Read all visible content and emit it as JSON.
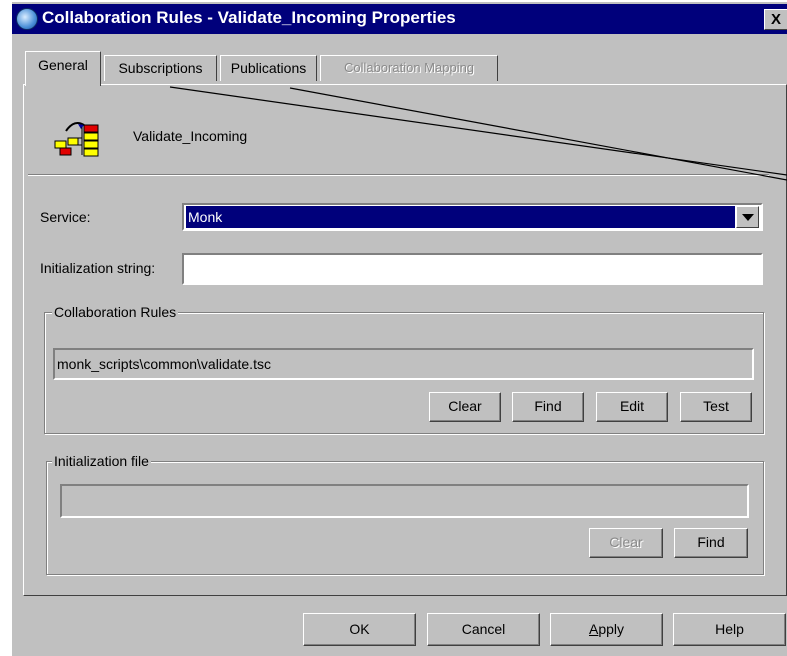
{
  "window": {
    "title": "Collaboration Rules - Validate_Incoming Properties",
    "close_label": "X"
  },
  "tabs": [
    {
      "label": "General",
      "active": true
    },
    {
      "label": "Subscriptions"
    },
    {
      "label": "Publications"
    },
    {
      "label": "Collaboration Mapping",
      "disabled": true
    }
  ],
  "header": {
    "name": "Validate_Incoming"
  },
  "service": {
    "label": "Service:",
    "value": "Monk"
  },
  "init_string": {
    "label": "Initialization string:",
    "value": ""
  },
  "collab_rules": {
    "title": "Collaboration Rules",
    "path": "monk_scripts\\common\\validate.tsc",
    "buttons": {
      "clear": "Clear",
      "find": "Find",
      "edit": "Edit",
      "test": "Test"
    }
  },
  "init_file": {
    "title": "Initialization file",
    "value": "",
    "buttons": {
      "clear": "Clear",
      "find": "Find"
    }
  },
  "footer": {
    "ok": "OK",
    "cancel": "Cancel",
    "apply": "Apply",
    "help": "Help"
  },
  "icons": {
    "title": "globe-icon",
    "header": "collaboration-rules-icon"
  }
}
